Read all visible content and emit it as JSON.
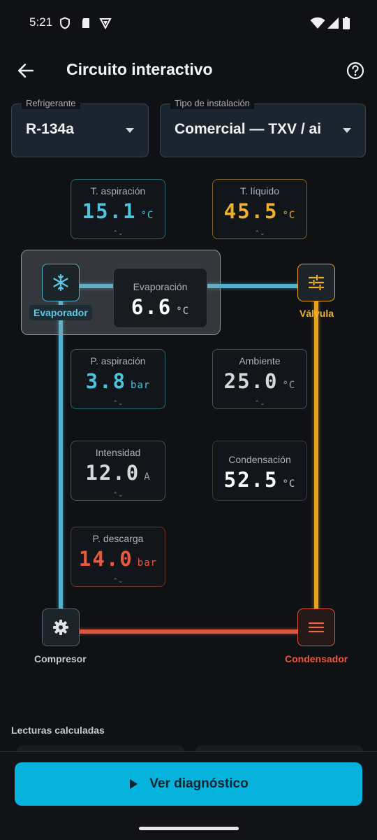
{
  "status_bar": {
    "time": "5:21"
  },
  "app_bar": {
    "title": "Circuito interactivo"
  },
  "fields": {
    "refrigerant": {
      "label": "Refrigerante",
      "value": "R-134a"
    },
    "installation": {
      "label": "Tipo de instalación",
      "value": "Comercial — TXV / ai"
    }
  },
  "components": {
    "evaporator": "Evaporador",
    "valve": "Válvula",
    "compressor": "Compresor",
    "condenser": "Condensador"
  },
  "readings": {
    "suction_temp": {
      "label": "T. aspiración",
      "value": "15.1",
      "unit": "°C"
    },
    "liquid_temp": {
      "label": "T. líquido",
      "value": "45.5",
      "unit": "°C"
    },
    "evaporation": {
      "label": "Evaporación",
      "value": "6.6",
      "unit": "°C"
    },
    "suction_pressure": {
      "label": "P. aspiración",
      "value": "3.8",
      "unit": "bar"
    },
    "ambient": {
      "label": "Ambiente",
      "value": "25.0",
      "unit": "°C"
    },
    "current": {
      "label": "Intensidad",
      "value": "12.0",
      "unit": "A"
    },
    "condensation": {
      "label": "Condensación",
      "value": "52.5",
      "unit": "°C"
    },
    "discharge_pressure": {
      "label": "P. descarga",
      "value": "14.0",
      "unit": "bar"
    }
  },
  "stepper_glyph": "⌃⌄",
  "section": {
    "calculated_readings": "Lecturas calculadas"
  },
  "cta": {
    "label": "Ver diagnóstico"
  },
  "colors": {
    "low_side": "#4fb3cf",
    "liquid_line": "#e8a21c",
    "discharge_line": "#d8573d",
    "accent_button": "#06b3dc"
  }
}
